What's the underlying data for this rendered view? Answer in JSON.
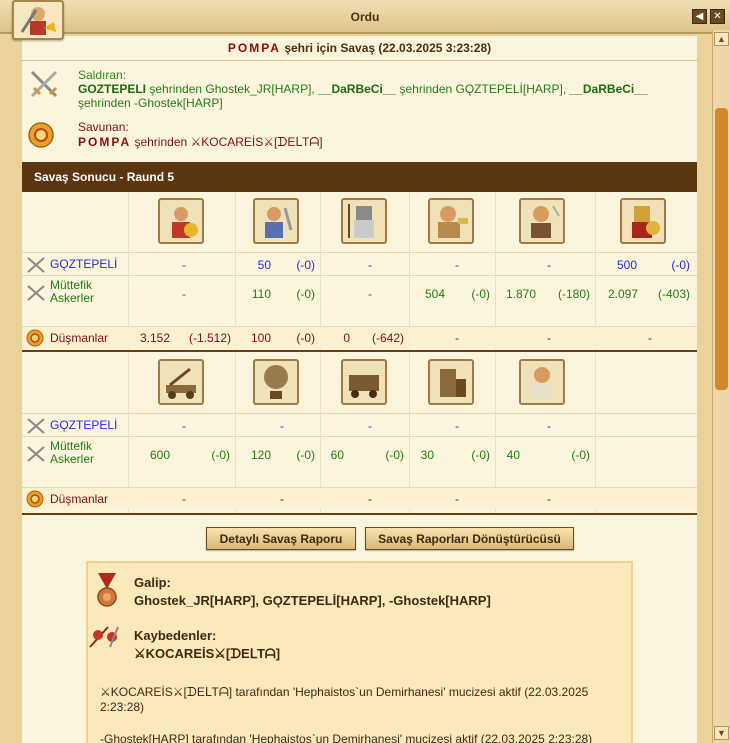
{
  "window": {
    "title": "Ordu"
  },
  "battle": {
    "city": "POMPA",
    "title_suffix": "şehri için Savaş (22.03.2025 3:23:28)"
  },
  "attacker": {
    "label": "Saldıran:",
    "a1": "GOZTEPELI",
    "t1": " şehrinden Ghostek_JR[HARP], ",
    "a2": "__DaRBeCi__",
    "t2": " şehrinden GǪZTEPELİ[HARP], ",
    "a3": "__DaRBeCi__",
    "t3": "şehrinden -Ghostek[HARP]"
  },
  "defender": {
    "label": "Savunan:",
    "city": "POMPA",
    "text": " şehrinden ⚔KOCAREİS⚔[ᗪEᒪTᗩ]"
  },
  "result": {
    "title": "Savaş Sonucu - Raund 5"
  },
  "rows": {
    "goztepeli": "GǪZTEPELİ",
    "allied1": "Müttefik",
    "allied2": "Askerler",
    "enemies": "Düşmanlar"
  },
  "table1": {
    "goztepeli": [
      [
        "-",
        ""
      ],
      [
        "50",
        "(-0)"
      ],
      [
        "-",
        ""
      ],
      [
        "-",
        ""
      ],
      [
        "-",
        ""
      ],
      [
        "500",
        "(-0)"
      ]
    ],
    "allied": [
      [
        "-",
        ""
      ],
      [
        "110",
        "(-0)"
      ],
      [
        "-",
        ""
      ],
      [
        "504",
        "(-0)"
      ],
      [
        "1.870",
        "(-180)"
      ],
      [
        "2.097",
        "(-403)"
      ]
    ],
    "enemies": [
      [
        "3.152",
        "(-1.512)"
      ],
      [
        "100",
        "(-0)"
      ],
      [
        "0",
        "(-642)"
      ],
      [
        "-",
        ""
      ],
      [
        "-",
        ""
      ],
      [
        "-",
        ""
      ]
    ]
  },
  "table2": {
    "goztepeli": [
      [
        "-",
        ""
      ],
      [
        "-",
        ""
      ],
      [
        "-",
        ""
      ],
      [
        "-",
        ""
      ],
      [
        "-",
        ""
      ]
    ],
    "allied": [
      [
        "600",
        "(-0)"
      ],
      [
        "120",
        "(-0)"
      ],
      [
        "60",
        "(-0)"
      ],
      [
        "30",
        "(-0)"
      ],
      [
        "40",
        "(-0)"
      ]
    ],
    "enemies": [
      [
        "-",
        ""
      ],
      [
        "-",
        ""
      ],
      [
        "-",
        ""
      ],
      [
        "-",
        ""
      ],
      [
        "-",
        ""
      ]
    ]
  },
  "buttons": {
    "detailed": "Detaylı Savaş Raporu",
    "converter": "Savaş Raporları Dönüştürücüsü"
  },
  "summary": {
    "winner_label": "Galip:",
    "winners": "Ghostek_JR[HARP], GǪZTEPELİ[HARP], -Ghostek[HARP]",
    "loser_label": "Kaybedenler:",
    "losers": "⚔KOCAREİS⚔[ᗪEᒪTᗩ]",
    "note1": "⚔KOCAREİS⚔[ᗪEᒪTᗩ] tarafından 'Hephaistos`un Demirhanesi' mucizesi aktif (22.03.2025 2:23:28)",
    "note2": "-Ghostek[HARP] tarafından 'Hephaistos`un Demirhanesi' mucizesi aktif (22.03.2025 2:23:28)"
  }
}
